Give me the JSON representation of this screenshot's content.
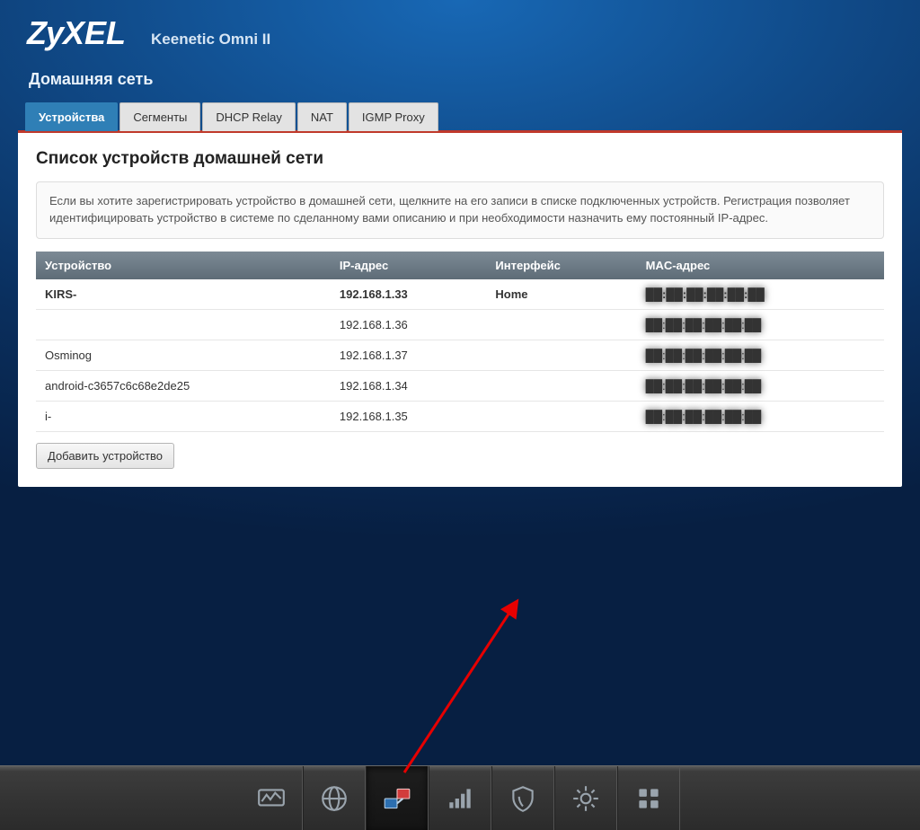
{
  "brand": "ZyXEL",
  "product": "Keenetic Omni II",
  "page_title": "Домашняя сеть",
  "tabs": [
    {
      "label": "Устройства",
      "active": true
    },
    {
      "label": "Сегменты",
      "active": false
    },
    {
      "label": "DHCP Relay",
      "active": false
    },
    {
      "label": "NAT",
      "active": false
    },
    {
      "label": "IGMP Proxy",
      "active": false
    }
  ],
  "panel": {
    "heading": "Список устройств домашней сети",
    "info": "Если вы хотите зарегистрировать устройство в домашней сети, щелкните на его записи в списке подключенных устройств. Регистрация позволяет идентифицировать устройство в системе по сделанному вами описанию и при необходимости назначить ему постоянный IP-адрес.",
    "columns": {
      "device": "Устройство",
      "ip": "IP-адрес",
      "iface": "Интерфейс",
      "mac": "MAC-адрес"
    },
    "rows": [
      {
        "device": "KIRS-",
        "ip": "192.168.1.33",
        "iface": "Home",
        "mac": "██:██:██:██:██:██",
        "highlight": true
      },
      {
        "device": "",
        "ip": "192.168.1.36",
        "iface": "",
        "mac": "██:██:██:██:██:██",
        "highlight": false
      },
      {
        "device": "Osminog",
        "ip": "192.168.1.37",
        "iface": "",
        "mac": "██:██:██:██:██:██",
        "highlight": false
      },
      {
        "device": "android-c3657c6c68e2de25",
        "ip": "192.168.1.34",
        "iface": "",
        "mac": "██:██:██:██:██:██",
        "highlight": false
      },
      {
        "device": "і-",
        "ip": "192.168.1.35",
        "iface": "",
        "mac": "██:██:██:██:██:██",
        "highlight": false
      }
    ],
    "add_button": "Добавить устройство"
  },
  "toolbar": [
    {
      "name": "monitor",
      "active": false
    },
    {
      "name": "globe",
      "active": false
    },
    {
      "name": "network",
      "active": true
    },
    {
      "name": "signal",
      "active": false
    },
    {
      "name": "shield",
      "active": false
    },
    {
      "name": "gear",
      "active": false
    },
    {
      "name": "apps",
      "active": false
    }
  ]
}
